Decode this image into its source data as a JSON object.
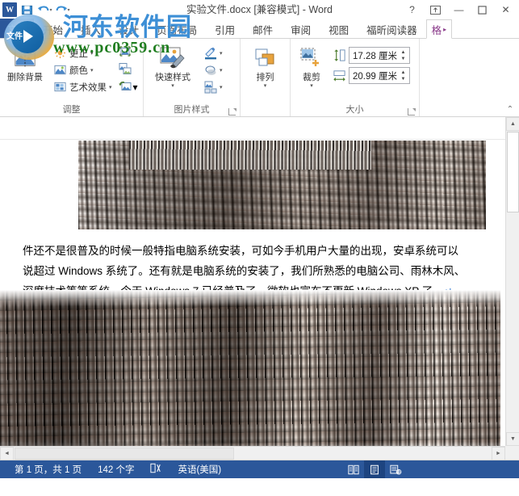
{
  "titlebar": {
    "app_icon": "word-logo",
    "quick_access": [
      {
        "name": "save-icon",
        "label": "保存"
      },
      {
        "name": "undo-icon",
        "label": "撤消"
      },
      {
        "name": "redo-icon",
        "label": "恢复"
      }
    ],
    "title": "实验文件.docx [兼容模式] - Word",
    "window_controls": [
      {
        "name": "help-button",
        "glyph": "?"
      },
      {
        "name": "ribbon-display-options-button",
        "glyph": "⊡"
      },
      {
        "name": "minimize-button",
        "glyph": "—"
      },
      {
        "name": "maximize-button",
        "glyph": "▢"
      },
      {
        "name": "close-button",
        "glyph": "✕"
      }
    ]
  },
  "tabs": {
    "file_label": "文件",
    "items": [
      {
        "label": "开始"
      },
      {
        "label": "插入"
      },
      {
        "label": "设计"
      },
      {
        "label": "页面布局"
      },
      {
        "label": "引用"
      },
      {
        "label": "邮件"
      },
      {
        "label": "审阅"
      },
      {
        "label": "视图"
      },
      {
        "label": "福昕阅读器"
      }
    ],
    "contextual": {
      "label": "格",
      "arrow": "▸"
    }
  },
  "ribbon": {
    "groups": [
      {
        "title": "调整",
        "big_button": {
          "label": "删除背景",
          "icon": "remove-background-icon"
        },
        "small_buttons": [
          {
            "label": "更正",
            "icon": "corrections-icon",
            "caret": "▾"
          },
          {
            "label": "颜色",
            "icon": "color-icon",
            "caret": "▾"
          },
          {
            "label": "艺术效果",
            "icon": "artistic-effects-icon",
            "caret": "▾"
          }
        ],
        "icon_buttons": [
          {
            "icon": "compress-pictures-icon",
            "caret": ""
          },
          {
            "icon": "change-picture-icon",
            "caret": ""
          },
          {
            "icon": "reset-picture-icon",
            "caret": "▾"
          }
        ]
      },
      {
        "title": "图片样式",
        "big_button": {
          "label": "快速样式",
          "icon": "quick-styles-icon",
          "caret": "▾"
        },
        "small_buttons": [
          {
            "label": "",
            "icon": "picture-border-icon",
            "caret": "▾"
          },
          {
            "label": "",
            "icon": "picture-effects-icon",
            "caret": "▾"
          },
          {
            "label": "",
            "icon": "picture-layout-icon",
            "caret": "▾"
          }
        ],
        "has_dialog_launcher": true
      },
      {
        "title": "排列",
        "big_button": {
          "label": "排列",
          "icon": "arrange-icon",
          "caret": "▾"
        }
      },
      {
        "title": "大小",
        "big_button": {
          "label": "裁剪",
          "icon": "crop-icon",
          "caret": "▾"
        },
        "size_fields": [
          {
            "name": "shape-height",
            "icon": "height-icon",
            "value": "17.28 厘米"
          },
          {
            "name": "shape-width",
            "icon": "width-icon",
            "value": "20.99 厘米"
          }
        ],
        "has_dialog_launcher": true
      }
    ],
    "collapse_glyph": "⌃"
  },
  "document": {
    "paragraph_lines": [
      "件还不是很普及的时候一般特指电脑系统安装，可如今手机用户大量的出现，安卓系统可以",
      "说超过 Windows 系统了。还有就是电脑系统的安装了，我们所熟悉的电脑公司、雨林木风、",
      "深度技术等等系统，今天 Windows 7 已经普及了，微软也宣布不更新 Windows XP 了。"
    ],
    "paragraph_mark": "↵"
  },
  "scrollbars": {
    "v_up": "▲",
    "v_down": "▼",
    "h_left": "◄",
    "h_right": "►"
  },
  "statusbar": {
    "page": "第 1 页，共 1 页",
    "words": "142 个字",
    "proofing_icon": "proofing-errors-icon",
    "language": "英语(美国)",
    "views": [
      {
        "name": "read-mode-view-button",
        "glyph": "▤",
        "active": false
      },
      {
        "name": "print-layout-view-button",
        "glyph": "▣",
        "active": true
      },
      {
        "name": "web-layout-view-button",
        "glyph": "▨",
        "active": false
      }
    ]
  },
  "watermark": {
    "text": "河东软件园",
    "url": "www.pc0359.cn",
    "badge": "文件"
  },
  "colors": {
    "accent": "#2b579a",
    "watermark_blue": "#3d8fd6",
    "watermark_green": "#1f7d1f",
    "contextual_tab": "#8a3a8a"
  }
}
